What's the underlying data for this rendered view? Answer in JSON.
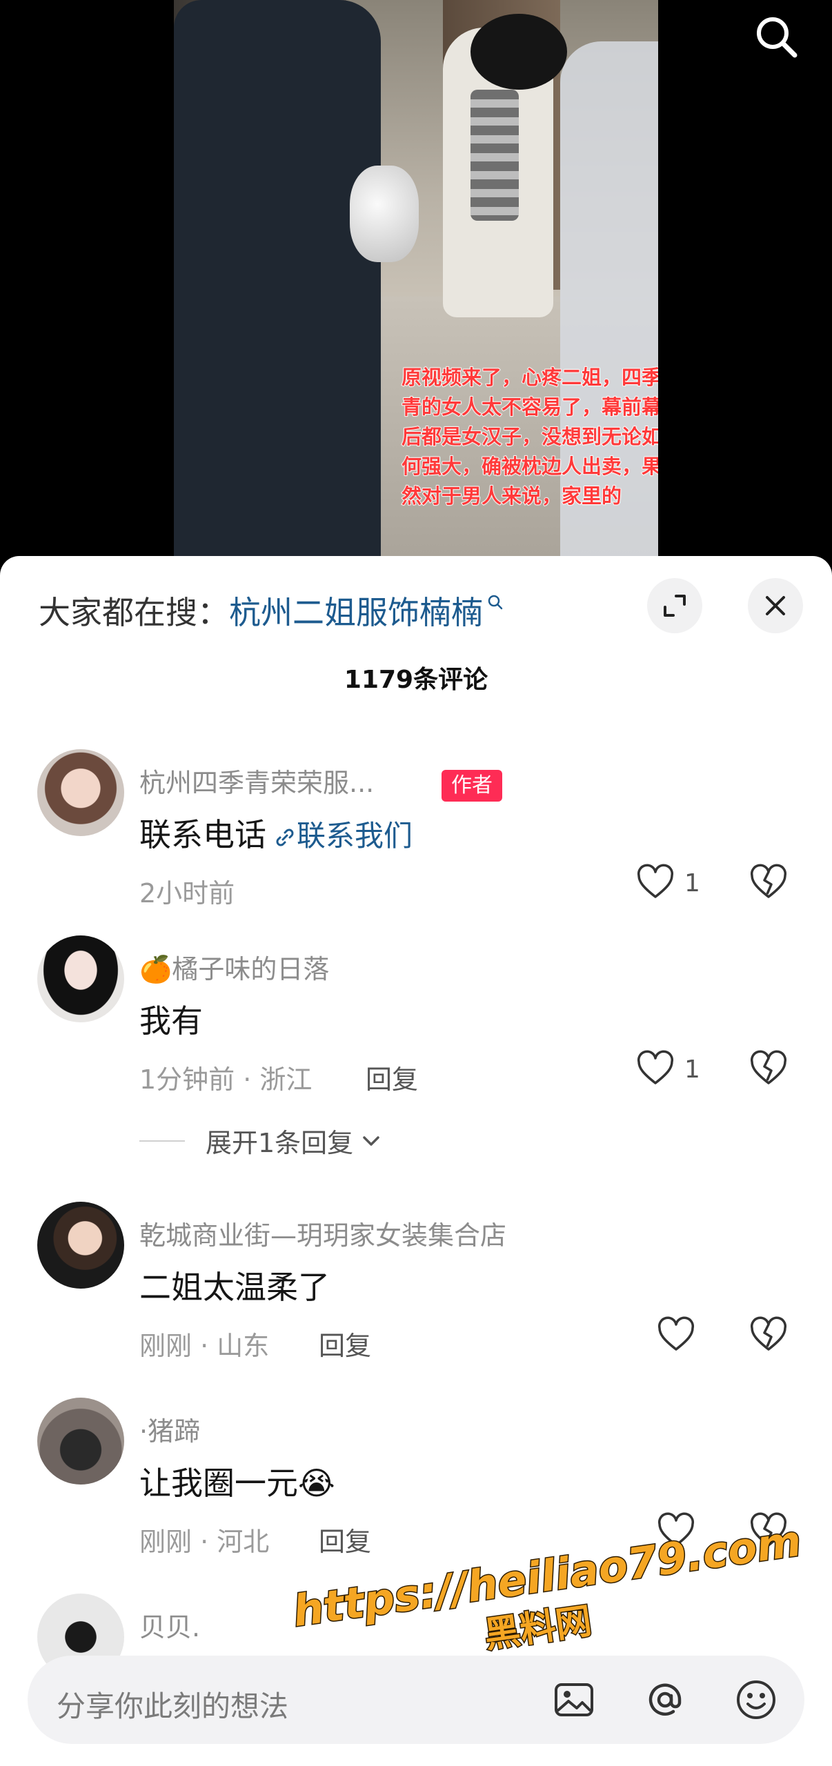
{
  "video": {
    "caption": "原视频来了，心疼二姐，四季青的女人太不容易了，幕前幕后都是女汉子，没想到无论如何强大，确被枕边人出卖，果然对于男人来说，家里的"
  },
  "search_hint": {
    "label": "大家都在搜：",
    "keyword": "杭州二姐服饰楠楠"
  },
  "comment_count": "1179条评论",
  "comments": [
    {
      "nickname": "杭州四季青荣荣服...",
      "badge": "作者",
      "text": "联系电话",
      "link_text": "联系我们",
      "meta": "2小时前",
      "likes": "1"
    },
    {
      "nickname": "🍊橘子味的日落",
      "text": "我有",
      "meta": "1分钟前 · 浙江",
      "reply_label": "回复",
      "likes": "1",
      "expand_replies": "展开1条回复"
    },
    {
      "nickname": "乾城商业街—玥玥家女装集合店",
      "text": "二姐太温柔了",
      "meta": "刚刚 · 山东",
      "reply_label": "回复"
    },
    {
      "nickname": "·猪蹄",
      "text": "让我圈一元😭",
      "meta": "刚刚 · 河北",
      "reply_label": "回复"
    },
    {
      "nickname": "贝贝."
    }
  ],
  "input": {
    "placeholder": "分享你此刻的想法"
  },
  "watermark": {
    "url": "https://heiliao79.com",
    "name": "黑料网"
  },
  "colors": {
    "accent_link": "#1d5b8f",
    "author_badge": "#fe2c55",
    "watermark": "#f5a623"
  },
  "icons": [
    "search-icon",
    "expand-icon",
    "close-icon",
    "link-icon",
    "heart-icon",
    "broken-heart-icon",
    "image-icon",
    "at-icon",
    "emoji-icon"
  ]
}
